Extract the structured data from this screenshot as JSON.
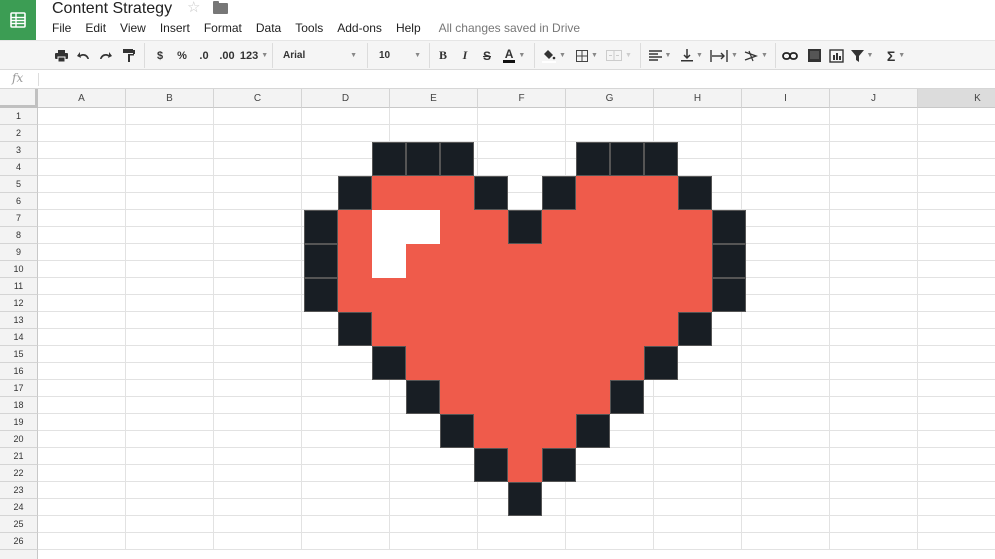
{
  "app": {
    "title": "Content Strategy",
    "logo_icon": "sheets-logo-icon",
    "star_icon": "star-icon",
    "folder_icon": "folder-icon"
  },
  "menu": {
    "items": [
      "File",
      "Edit",
      "View",
      "Insert",
      "Format",
      "Data",
      "Tools",
      "Add-ons",
      "Help"
    ],
    "status": "All changes saved in Drive"
  },
  "toolbar": {
    "currency": "$",
    "percent": "%",
    "decrease_decimal": ".0",
    "increase_decimal": ".00",
    "more_formats": "123",
    "font": "Arial",
    "font_size": "10",
    "bold": "B",
    "italic": "I",
    "strike": "S",
    "text_color": "A",
    "sum": "Σ"
  },
  "formula_bar": {
    "label": "fx",
    "value": ""
  },
  "grid": {
    "columns": [
      "A",
      "B",
      "C",
      "D",
      "E",
      "F",
      "G",
      "H",
      "I",
      "J",
      "K"
    ],
    "selected_column": "K",
    "rows": [
      "1",
      "2",
      "3",
      "4",
      "5",
      "6",
      "7",
      "8",
      "9",
      "10",
      "11",
      "12",
      "13",
      "14",
      "15",
      "16",
      "17",
      "18",
      "19",
      "20",
      "21",
      "22",
      "23",
      "24",
      "25",
      "26"
    ]
  },
  "drawing": {
    "name": "pixel-heart",
    "colors": {
      "k": "#181e24",
      "r": "#ef5b4b",
      "w": "#ffffff"
    },
    "pixels": [
      "..kkk...kkk..",
      ".krrrk.krrrk.",
      "krwwrrkrrrrrk",
      "krwrrrrrrrrrk",
      "krrrrrrrrrrrk",
      ".krrrrrrrrrk.",
      "..krrrrrrrk..",
      "...krrrrrk...",
      "....krrrk....",
      ".....krk.....",
      "......k......"
    ]
  }
}
